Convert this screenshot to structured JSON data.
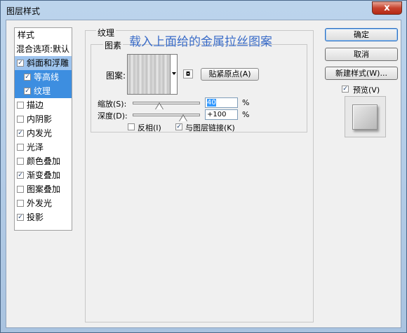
{
  "window": {
    "title": "图层样式",
    "close_glyph": "x"
  },
  "styles_list": {
    "header": "样式",
    "blending_options": "混合选项:默认",
    "items": [
      {
        "label": "斜面和浮雕",
        "checked": true
      },
      {
        "label": "等高线",
        "checked": true
      },
      {
        "label": "纹理",
        "checked": true
      },
      {
        "label": "描边",
        "checked": false
      },
      {
        "label": "内阴影",
        "checked": false
      },
      {
        "label": "内发光",
        "checked": true
      },
      {
        "label": "光泽",
        "checked": false
      },
      {
        "label": "颜色叠加",
        "checked": false
      },
      {
        "label": "渐变叠加",
        "checked": true
      },
      {
        "label": "图案叠加",
        "checked": false
      },
      {
        "label": "外发光",
        "checked": false
      },
      {
        "label": "投影",
        "checked": true
      }
    ],
    "check_glyph": "✓"
  },
  "texture_panel": {
    "group_title": "纹理",
    "subgroup_title": "图素",
    "annotation": "载入上面给的金属拉丝图案",
    "pattern_label": "图案:",
    "new_preset_glyph": "◘",
    "snap_origin_button": "贴紧原点(A)",
    "scale_label": "缩放(S):",
    "scale_value": "40",
    "scale_level": 0.4,
    "depth_label": "深度(D):",
    "depth_value": "+100",
    "depth_level": 0.75,
    "unit": "%",
    "invert_label": "反相(I)",
    "invert_checked": false,
    "link_label": "与图层链接(K)",
    "link_checked": true
  },
  "right_panel": {
    "ok_button": "确定",
    "cancel_button": "取消",
    "new_style_button": "新建样式(W)...",
    "preview_label": "预览(V)",
    "preview_checked": true
  }
}
